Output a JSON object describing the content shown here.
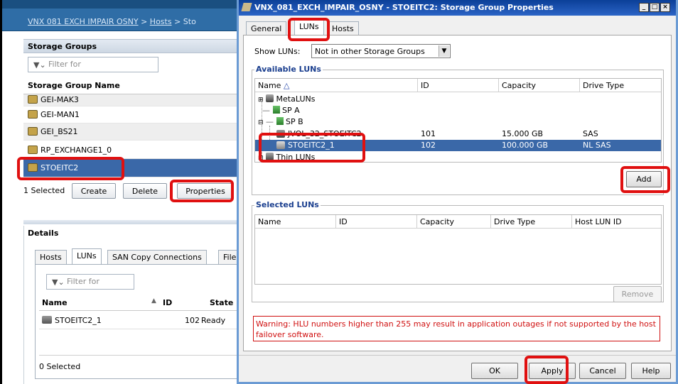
{
  "bg": {
    "breadcrumb": {
      "system": "VNX 081 EXCH IMPAIR OSNY",
      "sep1": ">",
      "hosts": "Hosts",
      "sep2": ">",
      "next": "Sto"
    },
    "storage_groups": {
      "title": "Storage Groups",
      "filter_placeholder": "Filter for",
      "column": "Storage Group Name",
      "rows": [
        "GEI-MAK3",
        "GEI-MAN1",
        "GEI_BS21",
        "RP_EXCHANGE1_0",
        "STOEITC2"
      ],
      "selected_count": "1 Selected",
      "create": "Create",
      "delete": "Delete",
      "properties": "Properties"
    },
    "details": {
      "title": "Details",
      "tabs": [
        "Hosts",
        "LUNs",
        "SAN Copy Connections",
        "File"
      ],
      "filter_placeholder": "Filter for",
      "columns": {
        "name": "Name",
        "id": "ID",
        "state": "State"
      },
      "row": {
        "name": "STOEITC2_1",
        "id": "102",
        "state": "Ready"
      },
      "selected_count": "0 Selected"
    }
  },
  "dialog": {
    "title": "VNX_081_EXCH_IMPAIR_OSNY - STOEITC2: Storage Group Properties",
    "tabs": [
      "General",
      "LUNs",
      "Hosts"
    ],
    "show_luns_label": "Show LUNs:",
    "show_luns_value": "Not in other Storage Groups",
    "available": {
      "label": "Available LUNs",
      "columns": {
        "name": "Name",
        "id": "ID",
        "capacity": "Capacity",
        "drive_type": "Drive Type"
      },
      "tree": {
        "metaluns": "MetaLUNs",
        "spa": "SP A",
        "spb": "SP B",
        "row1": {
          "name": "JVOL_32_STOEITC2",
          "id": "101",
          "capacity": "15.000 GB",
          "drive_type": "SAS"
        },
        "row2": {
          "name": "STOEITC2_1",
          "id": "102",
          "capacity": "100.000 GB",
          "drive_type": "NL SAS"
        },
        "thin": "Thin LUNs"
      },
      "add": "Add"
    },
    "selected": {
      "label": "Selected LUNs",
      "columns": {
        "name": "Name",
        "id": "ID",
        "capacity": "Capacity",
        "drive_type": "Drive Type",
        "host_lun_id": "Host LUN ID"
      },
      "remove": "Remove"
    },
    "warning": "Warning: HLU numbers higher than 255 may result in application outages if not supported by the host failover software.",
    "buttons": {
      "ok": "OK",
      "apply": "Apply",
      "cancel": "Cancel",
      "help": "Help"
    }
  },
  "colors": {
    "accent": "#3a68a8",
    "highlight_red": "#e01010",
    "title_bar": "#0b3f98",
    "group_label": "#1b3f8f",
    "warning_text": "#d01010"
  },
  "icons": [
    "storage-group-icon",
    "filter-icon",
    "lun-disk-icon",
    "metaluns-icon",
    "storage-processor-icon",
    "sort-up-icon",
    "dropdown-arrow-icon",
    "minimize-icon",
    "maximize-icon",
    "close-icon"
  ]
}
